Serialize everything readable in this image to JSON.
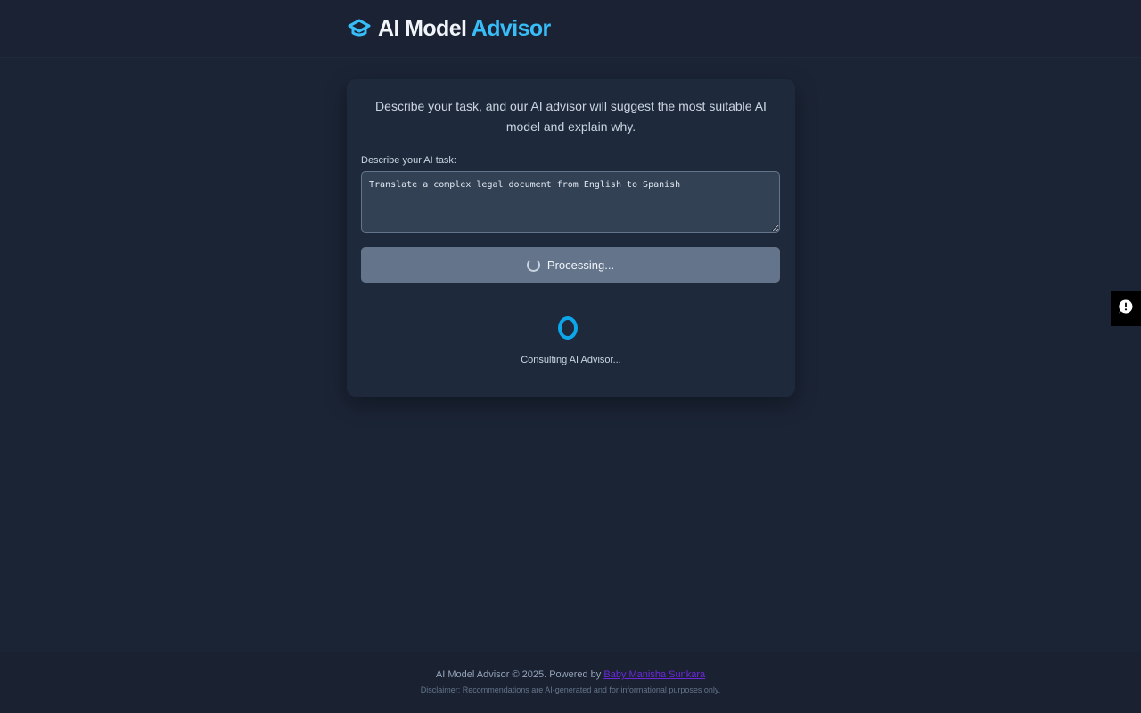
{
  "header": {
    "brand_primary": "AI Model",
    "brand_accent": "Advisor",
    "logo_icon": "graduation-cap-icon"
  },
  "card": {
    "intro": "Describe your task, and our AI advisor will suggest the most suitable AI model and explain why.",
    "task_label": "Describe your AI task:",
    "task_value": "Translate a complex legal document from English to Spanish",
    "submit_label": "Processing...",
    "loading_text": "Consulting AI Advisor..."
  },
  "feedback": {
    "icon": "feedback-icon"
  },
  "footer": {
    "copyright": "AI Model Advisor © 2025. Powered by",
    "author": "Baby Manisha Sunkara",
    "disclaimer": "Disclaimer: Recommendations are AI-generated and for informational purposes only."
  },
  "colors": {
    "accent": "#38bdf8",
    "background": "#1b2435",
    "card": "#1e293b",
    "button_disabled": "#64748b"
  }
}
